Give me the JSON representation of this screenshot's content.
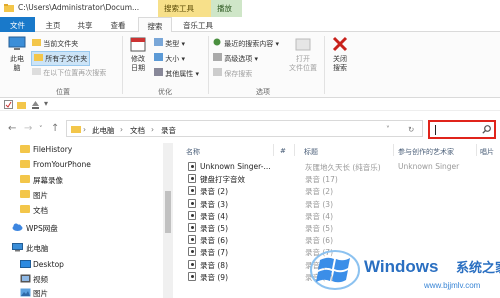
{
  "titlebar": {
    "path": "C:\\Users\\Administrator\\Docum...",
    "context_tab_search": "搜索工具",
    "context_tab_play": "播放"
  },
  "tabs": [
    {
      "label": "文件"
    },
    {
      "label": "主页"
    },
    {
      "label": "共享"
    },
    {
      "label": "查看"
    },
    {
      "label": "搜索"
    },
    {
      "label": "音乐工具"
    }
  ],
  "ribbon": {
    "location": {
      "this_pc": "此电\n脑",
      "current_folder": "当前文件夹",
      "all_subfolders": "所有子文件夹",
      "search_again": "在以下位置再次搜索",
      "group": "位置"
    },
    "refine": {
      "date_modified": "修改\n日期",
      "kind": "类型",
      "size": "大小",
      "other_properties": "其他属性",
      "group": "优化"
    },
    "options": {
      "recent_searches": "最近的搜索内容",
      "advanced_options": "高级选项",
      "save_search": "保存搜索",
      "open_file_location": "打开\n文件位置",
      "group": "选项"
    },
    "close": {
      "label": "关闭\n搜索"
    }
  },
  "address": {
    "crumbs": [
      "此电脑",
      "文档",
      "录音"
    ]
  },
  "search": {
    "value": ""
  },
  "nav": {
    "items": [
      {
        "label": "FileHistory",
        "icon": "folder-icon"
      },
      {
        "label": "FromYourPhone",
        "icon": "folder-icon"
      },
      {
        "label": "屏幕录像",
        "icon": "folder-icon"
      },
      {
        "label": "图片",
        "icon": "folder-icon"
      },
      {
        "label": "文档",
        "icon": "folder-icon"
      },
      {
        "label": "WPS网盘",
        "icon": "cloud-icon"
      },
      {
        "label": "此电脑",
        "icon": "computer-icon"
      },
      {
        "label": "Desktop",
        "icon": "desktop-icon"
      },
      {
        "label": "视频",
        "icon": "video-icon"
      },
      {
        "label": "图片",
        "icon": "pictures-icon"
      }
    ]
  },
  "columns": {
    "name": "名称",
    "number": "#",
    "title": "标题",
    "artist": "参与创作的艺术家",
    "album": "唱片"
  },
  "files": [
    {
      "name": "Unknown Singer-...",
      "number": "",
      "title": "灰匯地久天长 (纯音乐)",
      "artist": "Unknown Singer"
    },
    {
      "name": "键盘打字音效",
      "number": "",
      "title": "录音 (17)",
      "artist": ""
    },
    {
      "name": "录音 (2)",
      "number": "",
      "title": "录音 (2)",
      "artist": ""
    },
    {
      "name": "录音 (3)",
      "number": "",
      "title": "录音 (3)",
      "artist": ""
    },
    {
      "name": "录音 (4)",
      "number": "",
      "title": "录音 (4)",
      "artist": ""
    },
    {
      "name": "录音 (5)",
      "number": "",
      "title": "录音 (5)",
      "artist": ""
    },
    {
      "name": "录音 (6)",
      "number": "",
      "title": "录音 (6)",
      "artist": ""
    },
    {
      "name": "录音 (7)",
      "number": "",
      "title": "录音 (7)",
      "artist": ""
    },
    {
      "name": "录音 (8)",
      "number": "",
      "title": "录音 (8)",
      "artist": ""
    },
    {
      "name": "录音 (9)",
      "number": "",
      "title": "录音 (9)",
      "artist": ""
    }
  ],
  "watermark": {
    "brand": "Windows",
    "cn": "系统之家",
    "url": "www.bjjmlv.com"
  },
  "colors": {
    "file_tab": "#1979ca",
    "search_highlight": "#e0241b",
    "context_search": "#f7e08a",
    "context_play": "#cfe6c8",
    "watermark_blue": "#2a6fc1"
  }
}
